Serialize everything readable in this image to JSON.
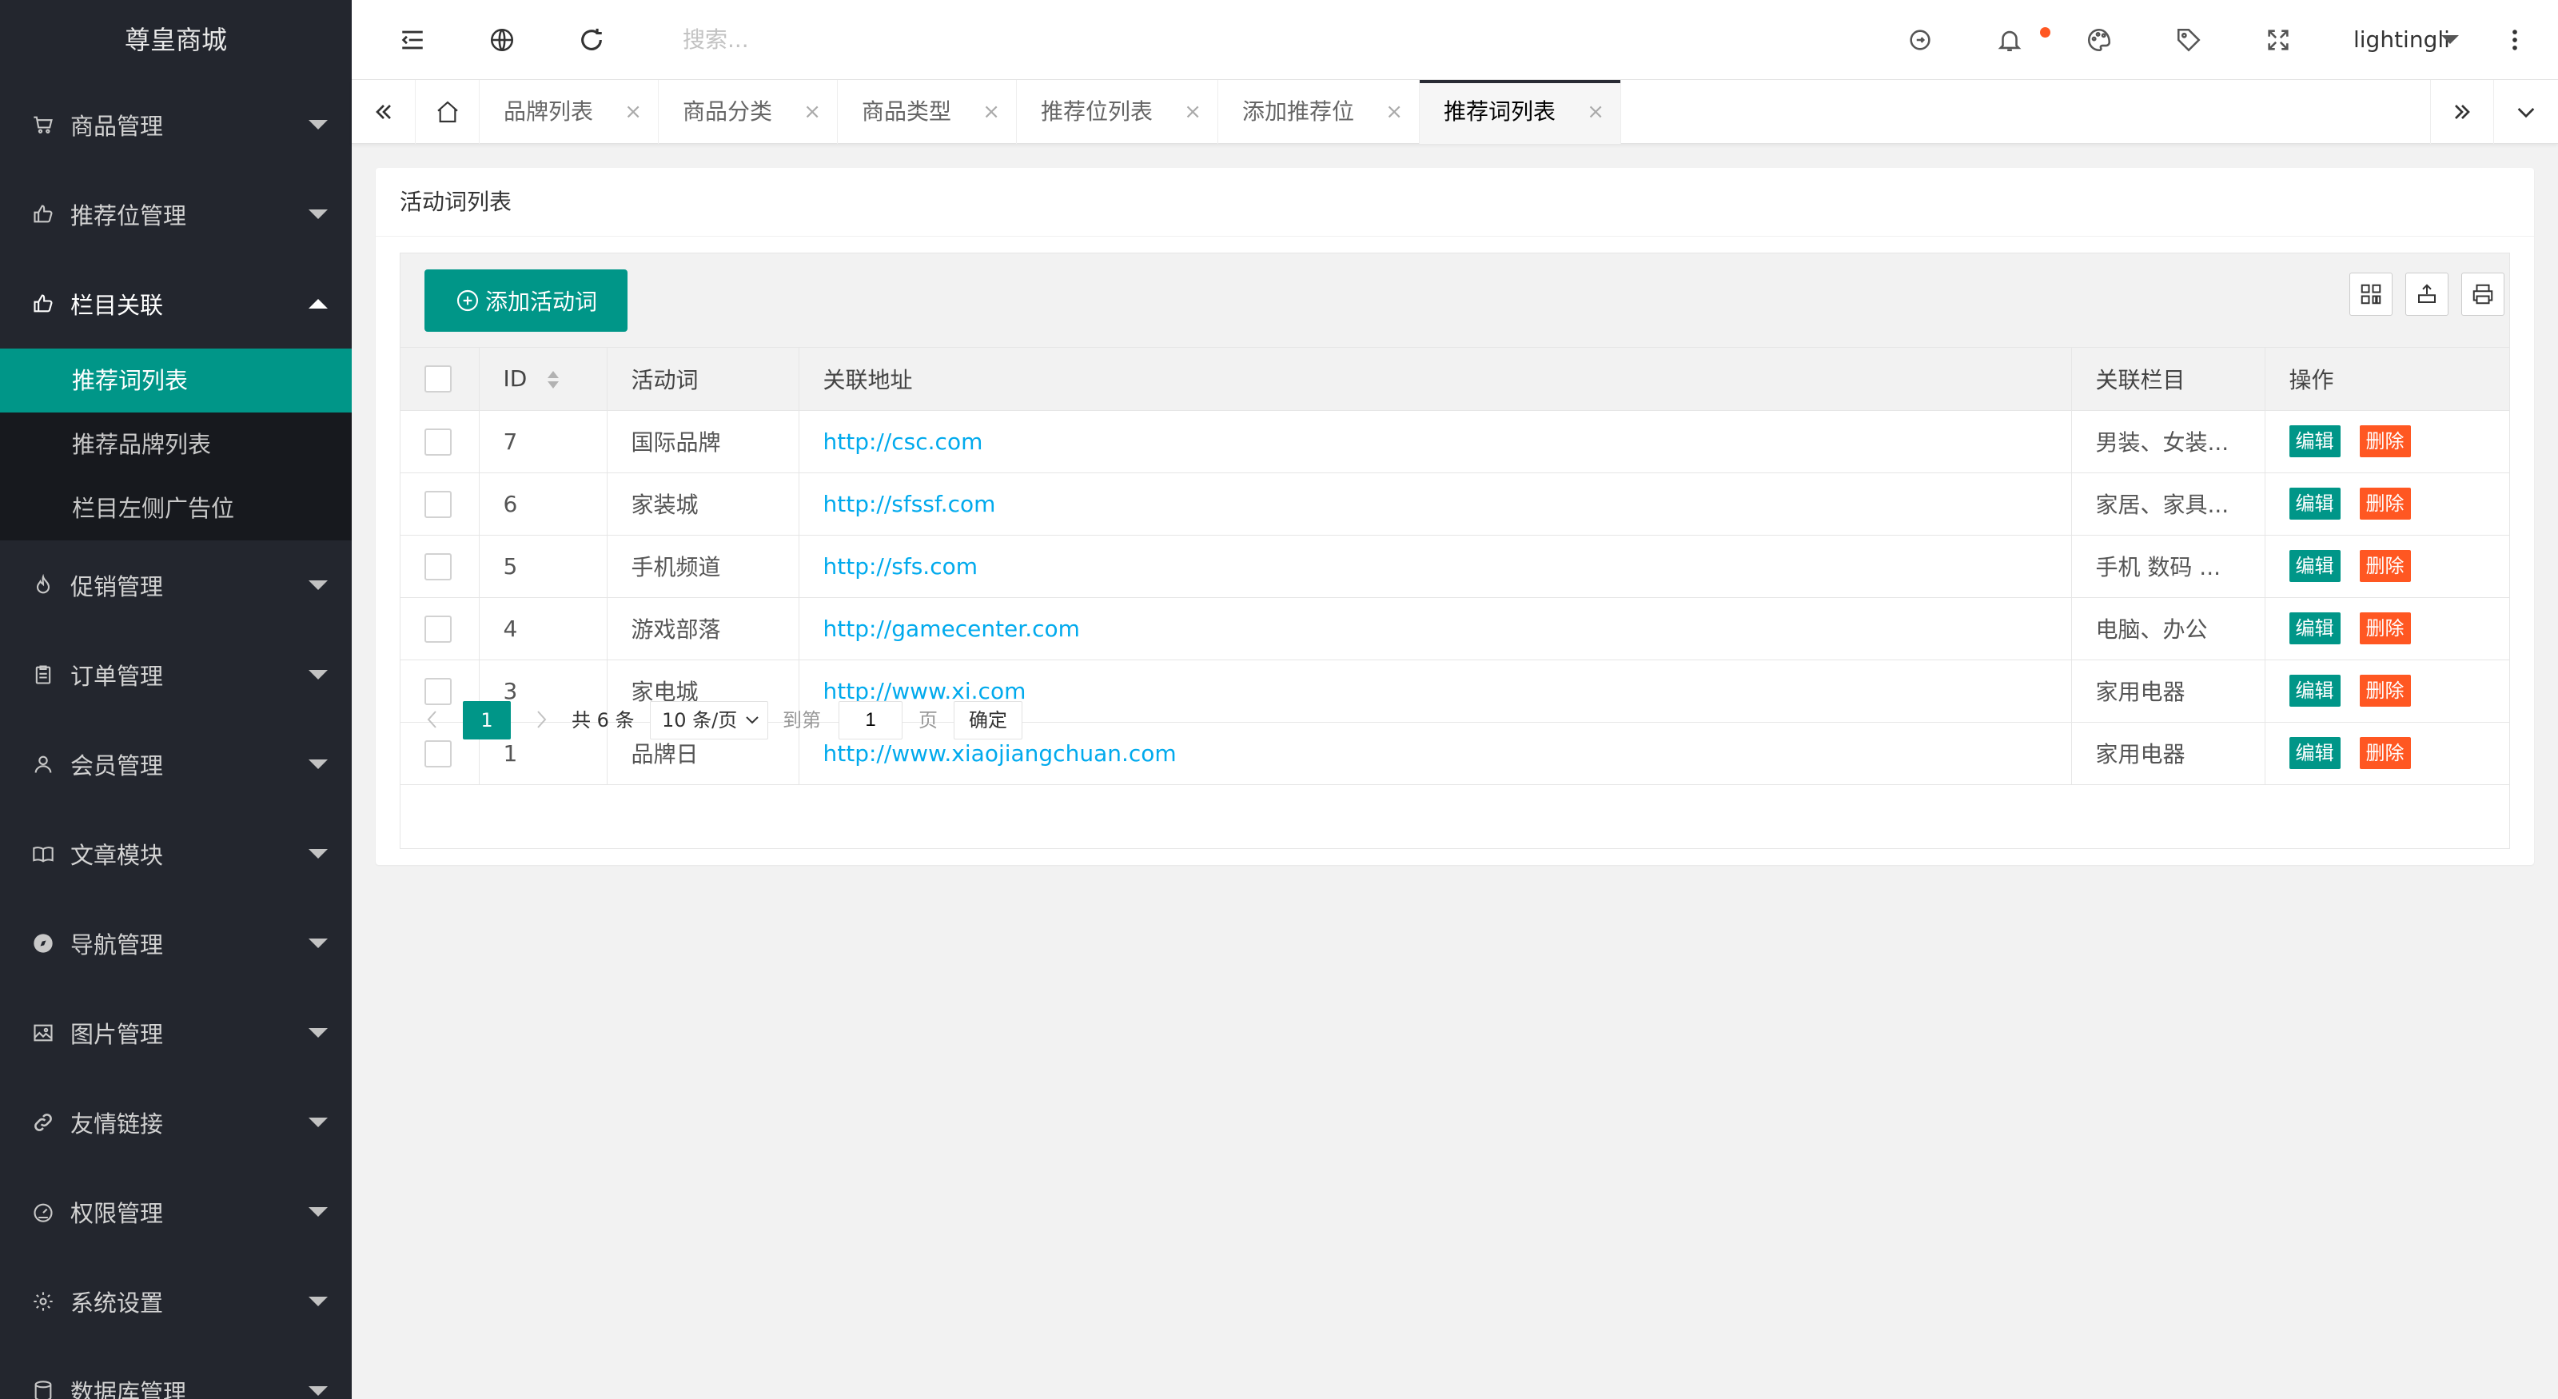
{
  "app": {
    "title": "尊皇商城"
  },
  "sidebar": {
    "items": [
      {
        "label": "商品管理",
        "icon": "cart-icon"
      },
      {
        "label": "推荐位管理",
        "icon": "thumb-up-icon"
      },
      {
        "label": "栏目关联",
        "icon": "thumb-up-icon",
        "open": true,
        "children": [
          {
            "label": "推荐词列表",
            "active": true
          },
          {
            "label": "推荐品牌列表"
          },
          {
            "label": "栏目左侧广告位"
          }
        ]
      },
      {
        "label": "促销管理",
        "icon": "fire-icon"
      },
      {
        "label": "订单管理",
        "icon": "clipboard-icon"
      },
      {
        "label": "会员管理",
        "icon": "user-icon"
      },
      {
        "label": "文章模块",
        "icon": "book-icon"
      },
      {
        "label": "导航管理",
        "icon": "compass-icon"
      },
      {
        "label": "图片管理",
        "icon": "image-icon"
      },
      {
        "label": "友情链接",
        "icon": "link-icon"
      },
      {
        "label": "权限管理",
        "icon": "gauge-icon"
      },
      {
        "label": "系统设置",
        "icon": "gear-icon"
      },
      {
        "label": "数据库管理",
        "icon": "database-icon"
      }
    ]
  },
  "header": {
    "search_placeholder": "搜索...",
    "username": "lightingli"
  },
  "tabs": {
    "items": [
      {
        "label": "品牌列表"
      },
      {
        "label": "商品分类"
      },
      {
        "label": "商品类型"
      },
      {
        "label": "推荐位列表"
      },
      {
        "label": "添加推荐位"
      },
      {
        "label": "推荐词列表",
        "active": true
      }
    ],
    "close_glyph": "×"
  },
  "card": {
    "title": "活动词列表",
    "add_button": "添加活动词"
  },
  "table": {
    "headers": {
      "id": "ID",
      "word": "活动词",
      "url": "关联地址",
      "category": "关联栏目",
      "actions": "操作"
    },
    "rows": [
      {
        "id": "7",
        "word": "国际品牌",
        "url": "http://csc.com",
        "category": "男装、女装..."
      },
      {
        "id": "6",
        "word": "家装城",
        "url": "http://sfssf.com",
        "category": "家居、家具..."
      },
      {
        "id": "5",
        "word": "手机频道",
        "url": "http://sfs.com",
        "category": "手机 数码 ..."
      },
      {
        "id": "4",
        "word": "游戏部落",
        "url": "http://gamecenter.com",
        "category": "电脑、办公"
      },
      {
        "id": "3",
        "word": "家电城",
        "url": "http://www.xi.com",
        "category": "家用电器"
      },
      {
        "id": "1",
        "word": "品牌日",
        "url": "http://www.xiaojiangchuan.com",
        "category": "家用电器"
      }
    ],
    "edit_label": "编辑",
    "delete_label": "删除"
  },
  "pager": {
    "current": "1",
    "total": "共 6 条",
    "page_size": "10 条/页",
    "goto_label": "到第",
    "goto_value": "1",
    "page_label": "页",
    "confirm": "确定"
  },
  "colors": {
    "primary": "#009688",
    "danger": "#ff5722",
    "link": "#01aaed",
    "sidebar": "#23262e"
  }
}
